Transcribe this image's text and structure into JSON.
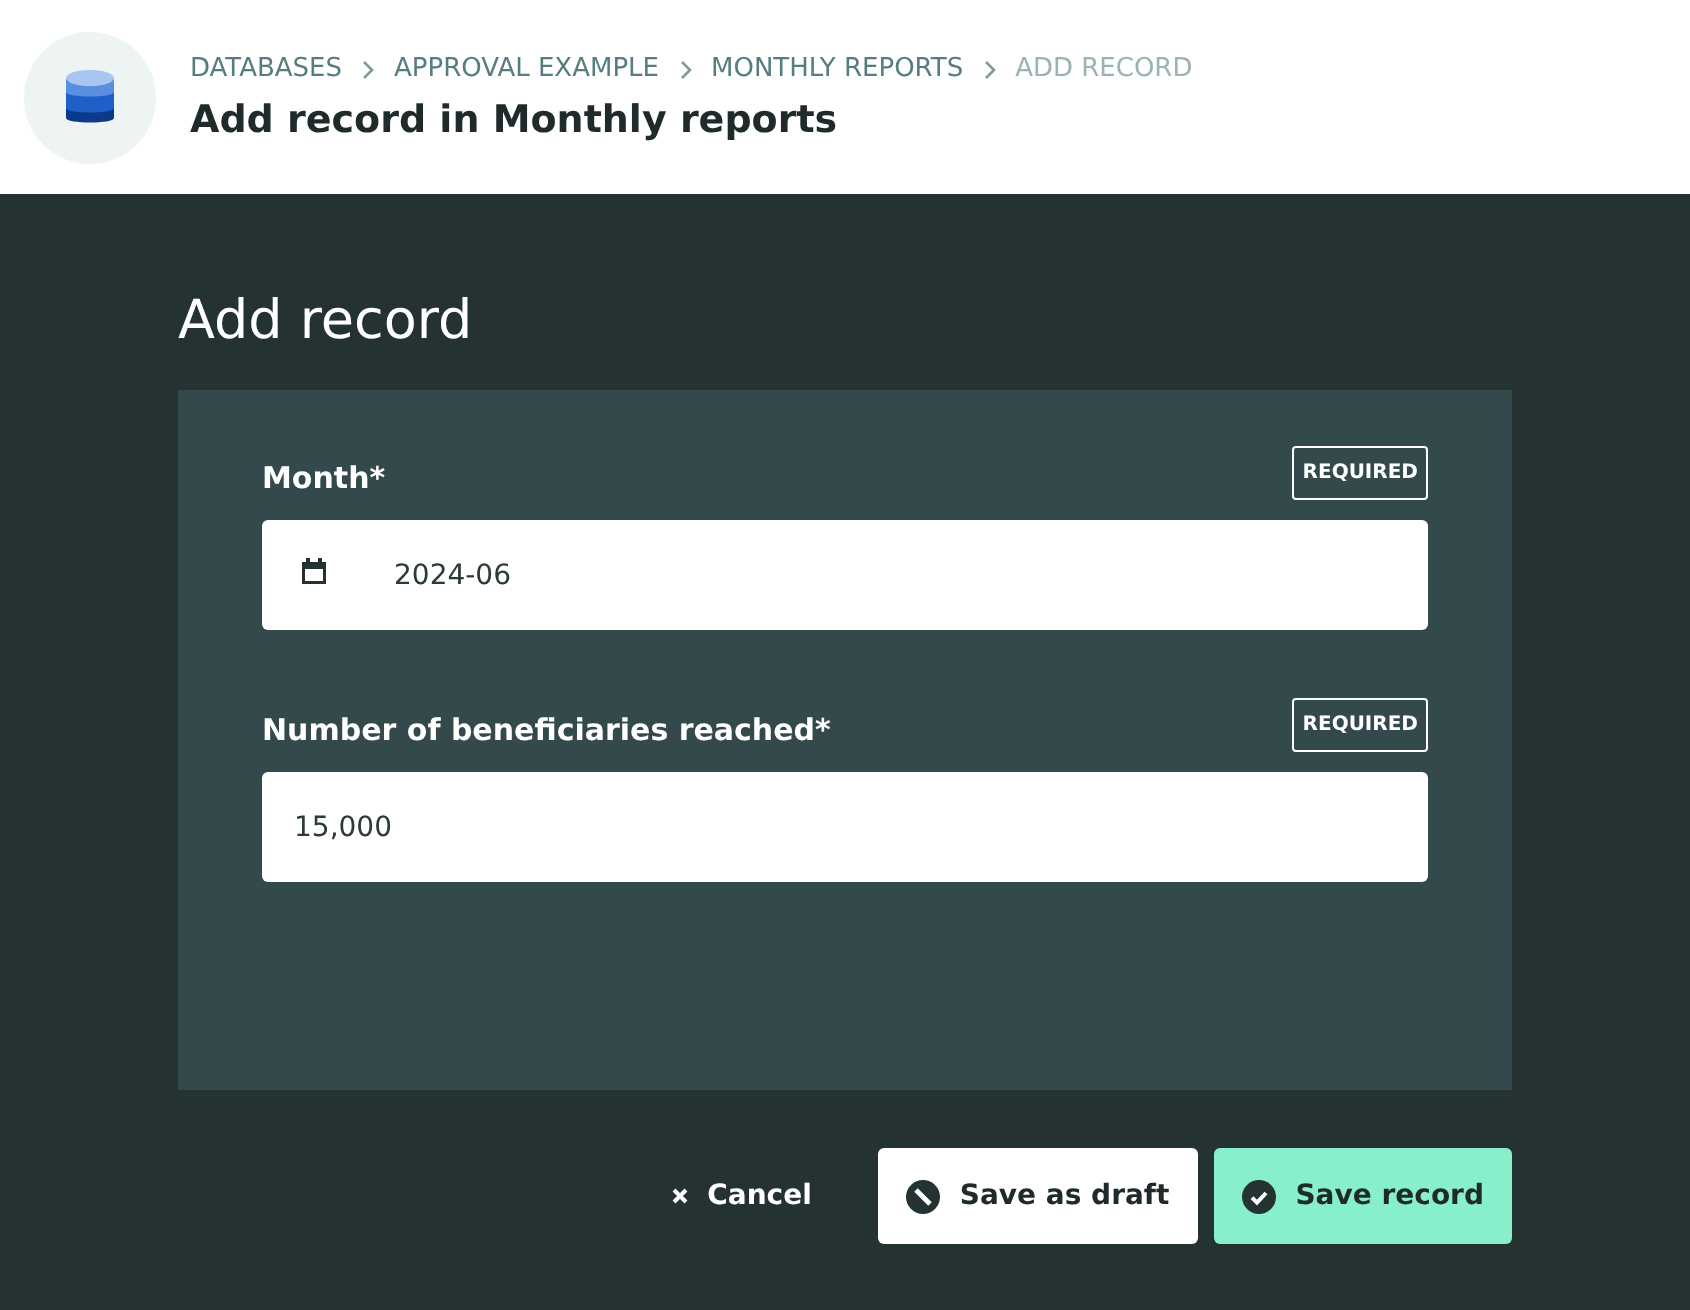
{
  "header": {
    "breadcrumbs": [
      {
        "label": "DATABASES",
        "current": false
      },
      {
        "label": "APPROVAL EXAMPLE",
        "current": false
      },
      {
        "label": "MONTHLY REPORTS",
        "current": false
      },
      {
        "label": "ADD RECORD",
        "current": true
      }
    ],
    "title": "Add record in Monthly reports"
  },
  "form": {
    "title": "Add record",
    "fields": [
      {
        "kind": "date",
        "label": "Month*",
        "badge": "REQUIRED",
        "value": "2024-06"
      },
      {
        "kind": "number",
        "label": "Number of beneficiaries reached*",
        "badge": "REQUIRED",
        "value": "15,000"
      }
    ]
  },
  "actions": [
    {
      "kind": "cancel",
      "label": "Cancel"
    },
    {
      "kind": "draft",
      "label": "Save as draft"
    },
    {
      "kind": "save",
      "label": "Save record"
    }
  ]
}
